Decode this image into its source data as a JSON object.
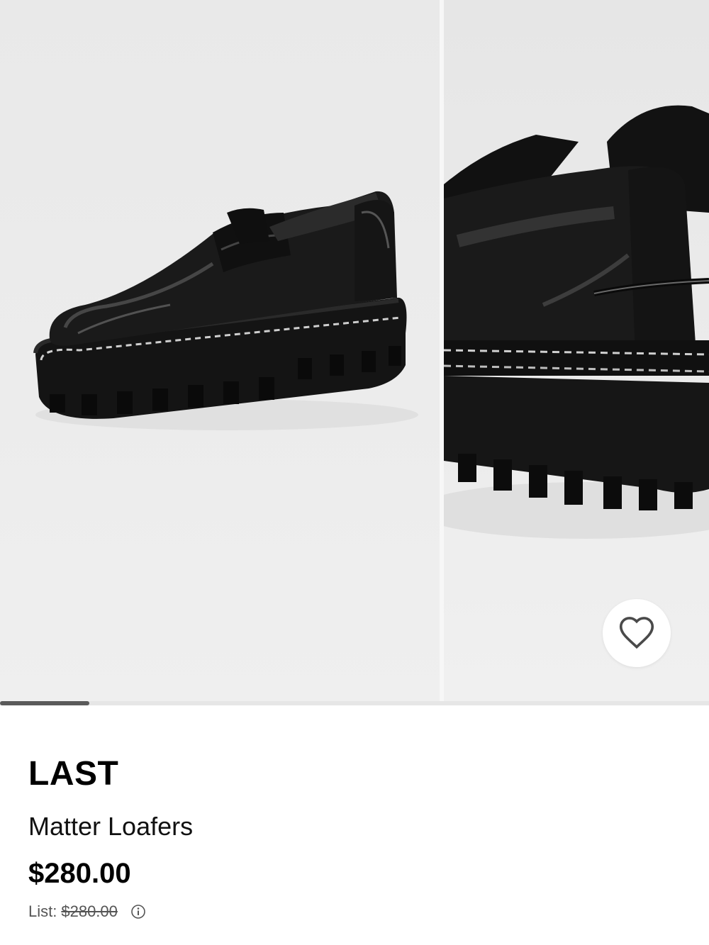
{
  "product": {
    "brand": "LAST",
    "name": "Matter Loafers",
    "price": "$280.00",
    "list_label": "List:",
    "list_price": "$280.00"
  },
  "gallery": {
    "slides": [
      "loafer-side-view",
      "loafer-heel-closeup"
    ],
    "current_slide": 1,
    "total_slides": 8
  },
  "icons": {
    "favorite": "heart-outline-icon",
    "info": "info-circle-icon"
  },
  "colors": {
    "text": "#000000",
    "muted": "#555555",
    "background": "#ffffff"
  }
}
